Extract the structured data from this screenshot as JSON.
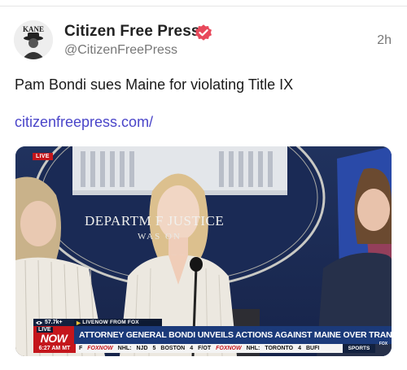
{
  "post": {
    "author_name": "Citizen Free Press",
    "handle": "@CitizenFreePress",
    "timestamp": "2h",
    "text": "Pam Bondi sues Maine for violating Title IX",
    "link": "citizenfreepress.com/",
    "avatar_text": "KANE"
  },
  "media": {
    "live_corner": "LIVE",
    "seal_title": "DEPARTM       F JUSTICE",
    "seal_subtitle": "WAS           ON",
    "chyron": {
      "views": "57.7k+",
      "livenow_from": "LIVENOW FROM FOX",
      "logo_live": "LIVE",
      "logo_now": "NOW",
      "headline": "ATTORNEY GENERAL BONDI UNVEILS ACTIONS AGAINST MAINE OVER TRANSGENDER POLICY",
      "clock": "6:27 AM MT",
      "ticker": [
        "F",
        "FOXNOW",
        "NHL:",
        "NJD",
        "5",
        "BOSTON",
        "4",
        "F/OT",
        "FOXNOW",
        "NHL:",
        "TORONTO",
        "4",
        "BUFI"
      ],
      "sports": "SPORTS",
      "fox_bug": "FOX"
    }
  },
  "colors": {
    "verified_badge": "#e8495b",
    "link": "#4a45c9",
    "chyron_blue": "#1b3a7a",
    "chyron_red": "#c4161c"
  },
  "icons": {
    "verified": "verified-badge-icon",
    "views": "eye-icon"
  }
}
